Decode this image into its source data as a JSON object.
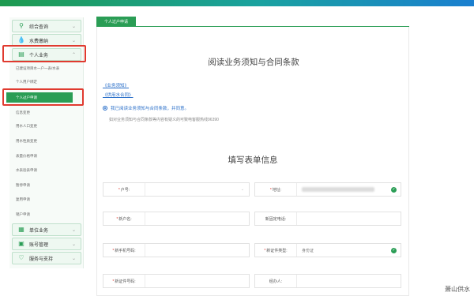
{
  "sidebar": {
    "items": [
      {
        "label": "综合查询",
        "icon": "search-icon"
      },
      {
        "label": "水费缴纳",
        "icon": "water-drop-icon"
      },
      {
        "label": "个人业务",
        "icon": "briefcase-icon"
      },
      {
        "label": "单位业务",
        "icon": "building-icon"
      },
      {
        "label": "账号管理",
        "icon": "id-card-icon"
      },
      {
        "label": "服务与支持",
        "icon": "heart-icon"
      }
    ],
    "sub_items": [
      "已建设项目水一户一表/水表",
      "个人用户绑定",
      "个人过户申请",
      "信息变更",
      "用水人口变更",
      "用水性质变更",
      "表量价格申请",
      "水表验表申请",
      "暂停申请",
      "复用申请",
      "销户申请"
    ]
  },
  "tab": {
    "label": "个人过户申请"
  },
  "main": {
    "title": "阅读业务须知与合同条款",
    "links": [
      "《业务须知》",
      "《供用水合同》"
    ],
    "agree_text": "我已阅读业务须知与合同条款，并同意。",
    "note": "如对业务须知与合同条款等内容有疑义的可致电客服热线96390",
    "form_title": "填写表单信息"
  },
  "form": {
    "fields": [
      {
        "label": "户号:",
        "required": true,
        "value": ""
      },
      {
        "label": "地址:",
        "required": true,
        "value": ""
      },
      {
        "label": "新户名:",
        "required": true,
        "value": ""
      },
      {
        "label": "新固定电话:",
        "required": false,
        "value": ""
      },
      {
        "label": "新手机号码:",
        "required": true,
        "value": ""
      },
      {
        "label": "新证件类型:",
        "required": true,
        "value": "身份证"
      },
      {
        "label": "新证件号码:",
        "required": true,
        "value": ""
      },
      {
        "label": "经办人:",
        "required": false,
        "value": ""
      }
    ]
  },
  "watermark": "萧山供水",
  "colors": {
    "accent": "#2a9d55",
    "highlight": "#e03a2f",
    "link": "#2a6fc9"
  }
}
